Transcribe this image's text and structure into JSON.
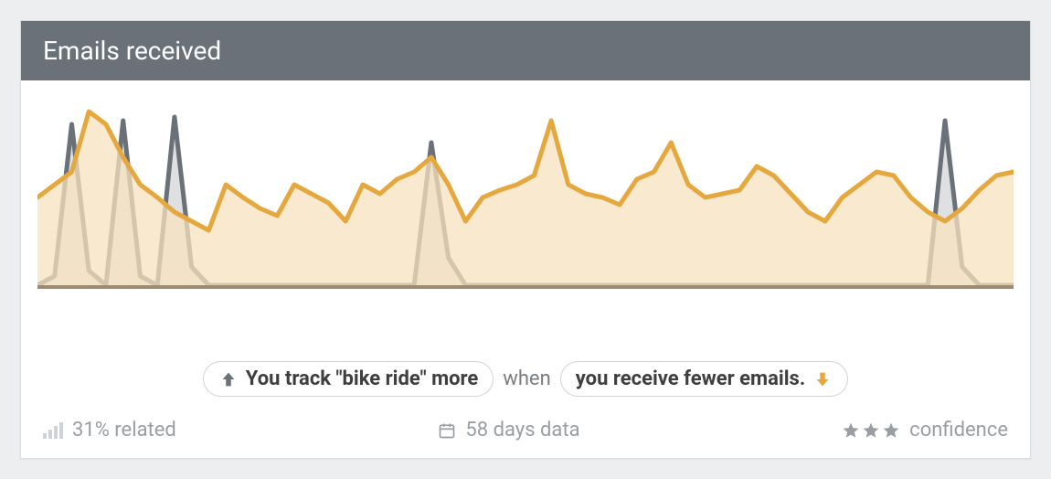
{
  "header": {
    "title": "Emails received"
  },
  "correlation": {
    "left_text": "You track \"bike ride\" more",
    "when": "when",
    "right_text": "you receive fewer emails."
  },
  "meta": {
    "related": "31% related",
    "days": "58 days data",
    "confidence_label": "confidence",
    "confidence_stars": 3
  },
  "colors": {
    "series_a_stroke": "#6b7178",
    "series_a_fill": "#c9ccce",
    "series_b_stroke": "#e5a83e",
    "series_b_fill": "#f7e3bf",
    "baseline": "#9d8c6f"
  },
  "chart_data": {
    "type": "area",
    "title": "Emails received",
    "xlabel": "",
    "ylabel": "",
    "x": [
      0,
      1,
      2,
      3,
      4,
      5,
      6,
      7,
      8,
      9,
      10,
      11,
      12,
      13,
      14,
      15,
      16,
      17,
      18,
      19,
      20,
      21,
      22,
      23,
      24,
      25,
      26,
      27,
      28,
      29,
      30,
      31,
      32,
      33,
      34,
      35,
      36,
      37,
      38,
      39,
      40,
      41,
      42,
      43,
      44,
      45,
      46,
      47,
      48,
      49,
      50,
      51,
      52,
      53,
      54,
      55,
      56,
      57
    ],
    "ylim": [
      0,
      100
    ],
    "series": [
      {
        "name": "bike ride tracked",
        "values": [
          0,
          5,
          88,
          8,
          0,
          90,
          5,
          0,
          92,
          10,
          0,
          0,
          0,
          0,
          0,
          0,
          0,
          0,
          0,
          0,
          0,
          0,
          0,
          78,
          15,
          0,
          0,
          0,
          0,
          0,
          0,
          0,
          0,
          0,
          0,
          0,
          0,
          0,
          0,
          0,
          0,
          0,
          0,
          0,
          0,
          0,
          0,
          0,
          0,
          0,
          0,
          0,
          0,
          90,
          10,
          0,
          0,
          0
        ]
      },
      {
        "name": "emails received",
        "values": [
          48,
          55,
          62,
          95,
          88,
          70,
          55,
          48,
          40,
          35,
          30,
          55,
          48,
          42,
          38,
          55,
          50,
          45,
          35,
          55,
          50,
          58,
          62,
          70,
          55,
          35,
          48,
          52,
          55,
          60,
          90,
          55,
          50,
          48,
          44,
          58,
          62,
          78,
          55,
          48,
          50,
          52,
          65,
          60,
          50,
          40,
          35,
          48,
          55,
          62,
          60,
          48,
          40,
          35,
          42,
          52,
          60,
          62
        ]
      }
    ]
  }
}
